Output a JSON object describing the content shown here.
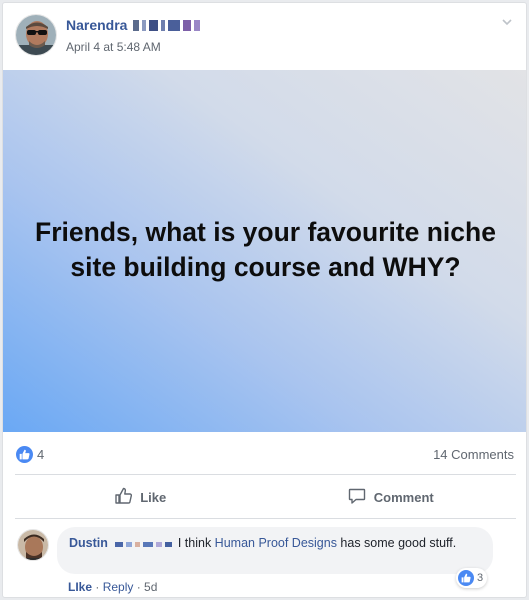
{
  "post": {
    "author": "Narendra",
    "timestamp": "April 4 at 5:48 AM",
    "banner_text": "Friends, what is your favourite niche site building course and WHY?",
    "reactions_count": "4",
    "comments_count": "14 Comments"
  },
  "actions": {
    "like_label": "Like",
    "comment_label": "Comment"
  },
  "comment": {
    "author": "Dustin",
    "text_before": " I think ",
    "link_text": "Human Proof Designs",
    "text_after": " has some good stuff.",
    "like_label": "LIke",
    "separator": " · ",
    "reply_label": "Reply",
    "age": "5d",
    "reaction_count": "3"
  },
  "colors": {
    "link_blue": "#385898",
    "like_blue": "#4a89f3",
    "meta_gray": "#606770"
  }
}
